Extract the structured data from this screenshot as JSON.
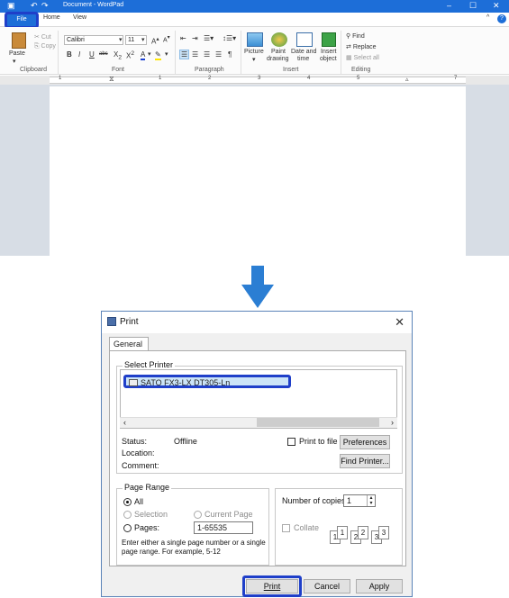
{
  "wordpad": {
    "title": "Document - WordPad",
    "tabs": {
      "file": "File",
      "home": "Home",
      "view": "View"
    },
    "clipboard": {
      "paste": "Paste",
      "cut": "Cut",
      "copy": "Copy",
      "label": "Clipboard"
    },
    "font": {
      "name": "Calibri",
      "size": "11",
      "label": "Font"
    },
    "paragraph": {
      "label": "Paragraph"
    },
    "insert": {
      "picture": "Picture",
      "paint_1": "Paint",
      "paint_2": "drawing",
      "datetime_1": "Date and",
      "datetime_2": "time",
      "object_1": "Insert",
      "object_2": "object",
      "label": "Insert"
    },
    "editing": {
      "find": "Find",
      "replace": "Replace",
      "select_all": "Select all",
      "label": "Editing"
    },
    "ruler_numbers": [
      "1",
      "2",
      "3",
      "4",
      "5",
      "7"
    ],
    "accent": "#1d6ed8",
    "highlight": "#1f3fc9"
  },
  "dialog": {
    "title": "Print",
    "tab": "General",
    "select_printer_label": "Select Printer",
    "printer_name": "SATO FX3-LX DT305-Ln",
    "status_label": "Status:",
    "status_value": "Offline",
    "location_label": "Location:",
    "comment_label": "Comment:",
    "print_to_file": "Print to file",
    "preferences": "Preferences",
    "find_printer": "Find Printer...",
    "page_range_label": "Page Range",
    "all": "All",
    "selection": "Selection",
    "current_page": "Current Page",
    "pages": "Pages:",
    "pages_value": "1-65535",
    "hint_1": "Enter either a single page number or a single",
    "hint_2": "page range.  For example, 5-12",
    "copies_label": "Number of copies:",
    "copies_value": "1",
    "collate": "Collate",
    "print_btn": "Print",
    "cancel_btn": "Cancel",
    "apply_btn": "Apply"
  }
}
